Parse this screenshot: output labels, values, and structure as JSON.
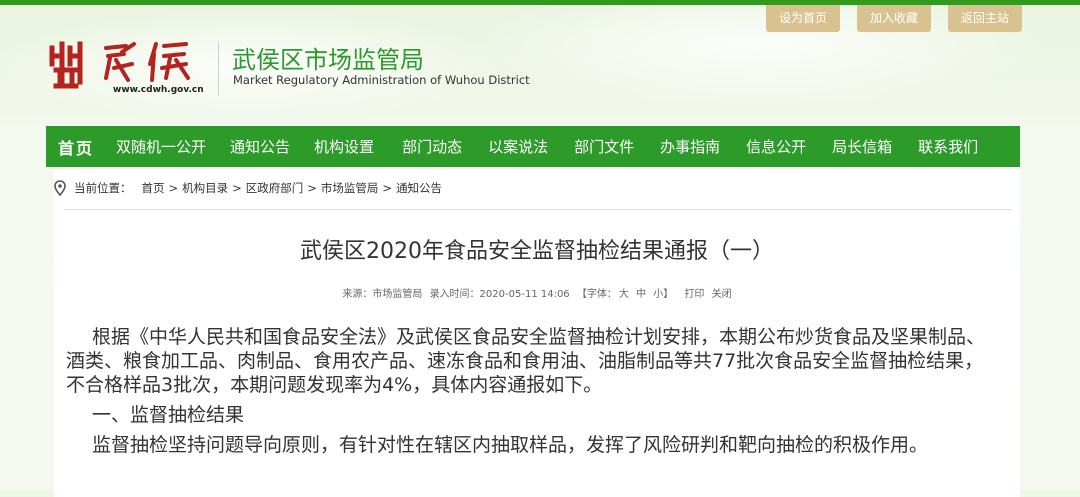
{
  "top_links": [
    "设为首页",
    "加入收藏",
    "返回主站"
  ],
  "logo": {
    "url_text": "www.cdwh.gov.cn",
    "mark_text": "武侯"
  },
  "site": {
    "title": "武侯区市场监管局",
    "subtitle": "Market Regulatory Administration of Wuhou District"
  },
  "nav": {
    "items": [
      "首页",
      "双随机一公开",
      "通知公告",
      "机构设置",
      "部门动态",
      "以案说法",
      "部门文件",
      "办事指南",
      "信息公开",
      "局长信箱",
      "联系我们"
    ]
  },
  "breadcrumb": {
    "label": "当前位置：",
    "items": [
      "首页",
      "机构目录",
      "区政府部门",
      "市场监管局",
      "通知公告"
    ],
    "separator": ">"
  },
  "article": {
    "title": "武侯区2020年食品安全监督抽检结果通报（一）",
    "meta": {
      "source": "来源：市场监管局",
      "time": "录入时间：2020-05-11 14:06",
      "font_label": "【字体：",
      "font_large": "大",
      "font_medium": "中",
      "font_small": "小】",
      "print": "打印",
      "close": "关闭"
    },
    "paragraphs": [
      "根据《中华人民共和国食品安全法》及武侯区食品安全监督抽检计划安排，本期公布炒货食品及坚果制品、酒类、粮食加工品、肉制品、食用农产品、速冻食品和食用油、油脂制品等共77批次食品安全监督抽检结果，不合格样品3批次，本期问题发现率为4%，具体内容通报如下。",
      "一、监督抽检结果",
      "监督抽检坚持问题导向原则，有针对性在辖区内抽取样品，发挥了风险研判和靶向抽检的积极作用。"
    ]
  },
  "colors": {
    "accent": "#2d9b2a",
    "top_link_bg": "#d8c290",
    "logo_red": "#b4231e"
  }
}
